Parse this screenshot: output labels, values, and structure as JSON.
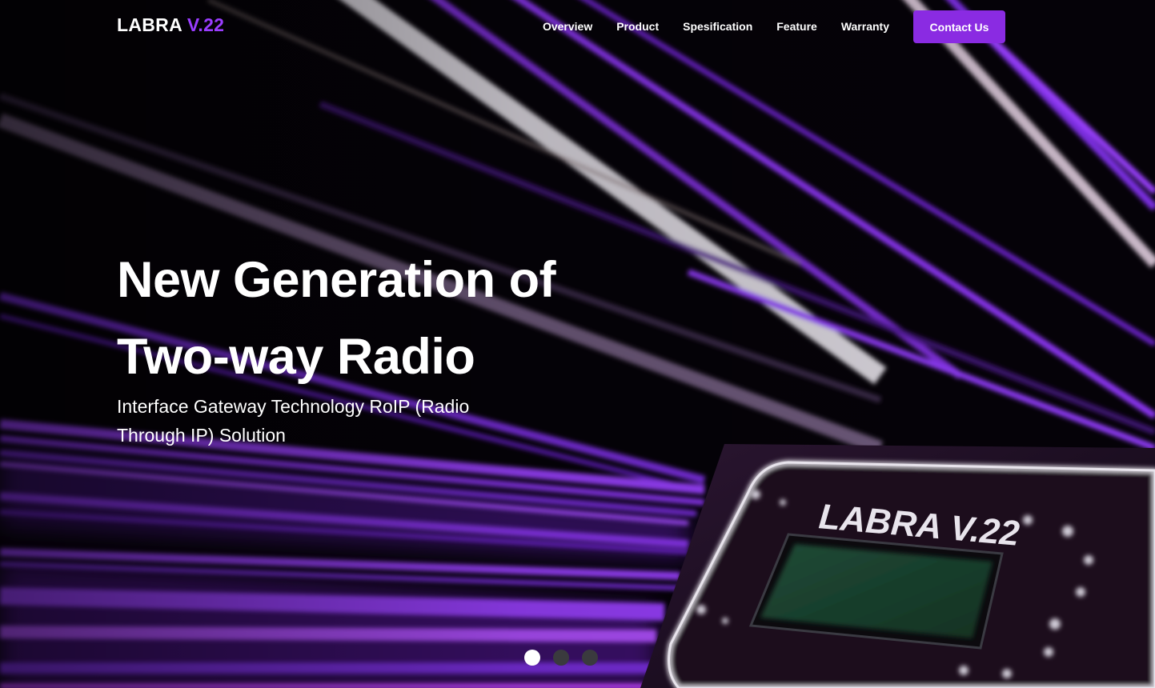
{
  "brand": {
    "name": "LABRA",
    "version": "V.22",
    "accent_color": "#9a3dff"
  },
  "nav": {
    "items": [
      {
        "label": "Overview"
      },
      {
        "label": "Product"
      },
      {
        "label": "Spesification"
      },
      {
        "label": "Feature"
      },
      {
        "label": "Warranty"
      }
    ],
    "cta_label": "Contact Us",
    "cta_color": "#8a2be2"
  },
  "hero": {
    "title_line1": "New Generation of",
    "title_line2": "Two-way Radio",
    "subtitle": "Interface Gateway Technology RoIP (Radio Through IP) Solution",
    "device_label": "LABRA V.22"
  },
  "carousel": {
    "slide_count": 3,
    "active_index": 0
  }
}
